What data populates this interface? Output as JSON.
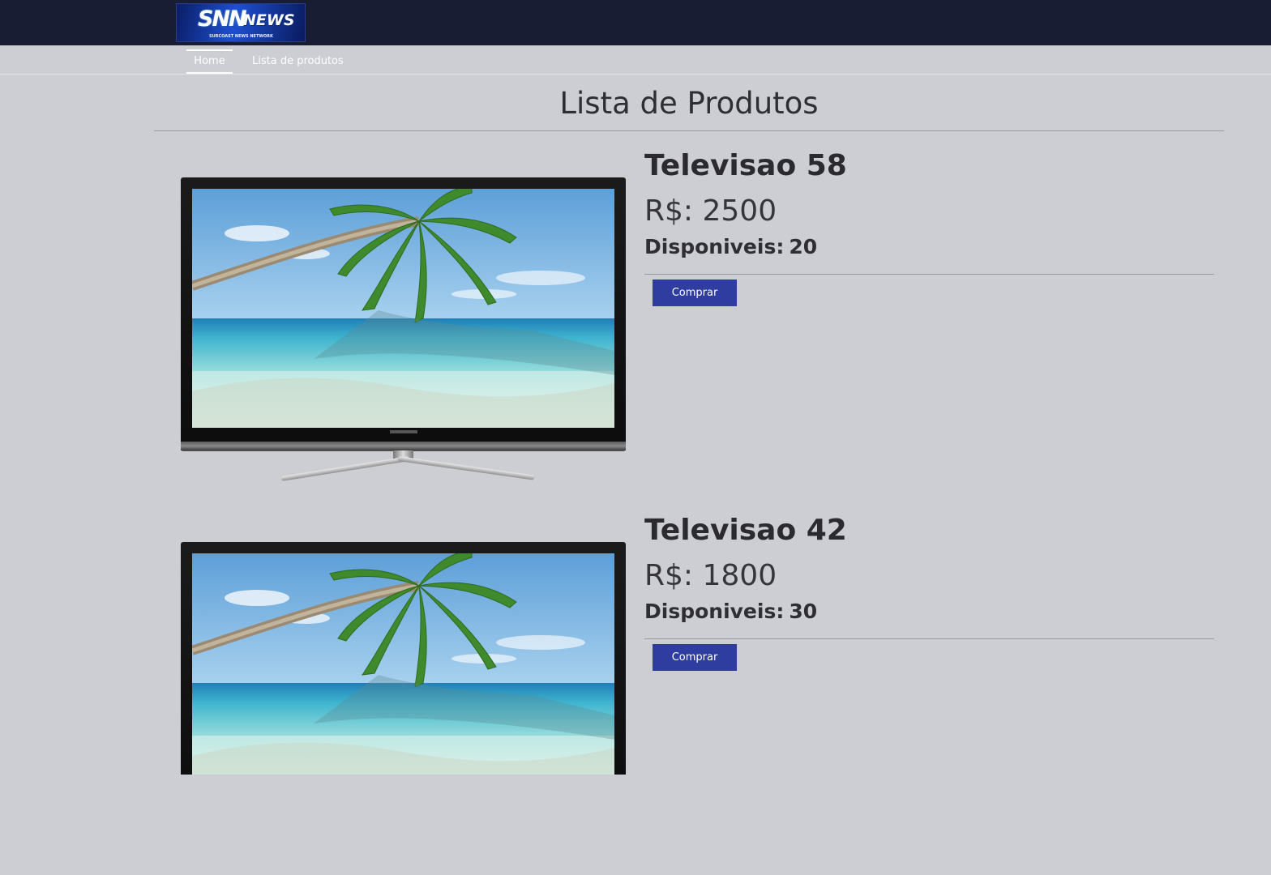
{
  "header": {
    "logo": {
      "main_text": "SNN",
      "accent_text": "NEWS",
      "tagline": "SURCOAST NEWS NETWORK"
    }
  },
  "nav": {
    "items": [
      {
        "label": "Home",
        "active": true
      },
      {
        "label": "Lista de produtos",
        "active": false
      }
    ]
  },
  "page": {
    "title": "Lista de Produtos"
  },
  "products": [
    {
      "name": "Televisao 58",
      "price": "R$: 2500",
      "stock_label": "Disponiveis:",
      "stock_value": "20",
      "buy_label": "Comprar",
      "image_icon": "television-beach-image"
    },
    {
      "name": "Televisao 42",
      "price": "R$: 1800",
      "stock_label": "Disponiveis:",
      "stock_value": "30",
      "buy_label": "Comprar",
      "image_icon": "television-beach-image"
    }
  ],
  "colors": {
    "header_bg": "#181d33",
    "page_bg": "#cdced3",
    "button_bg": "#2f3da0",
    "button_text": "#ffffff"
  }
}
